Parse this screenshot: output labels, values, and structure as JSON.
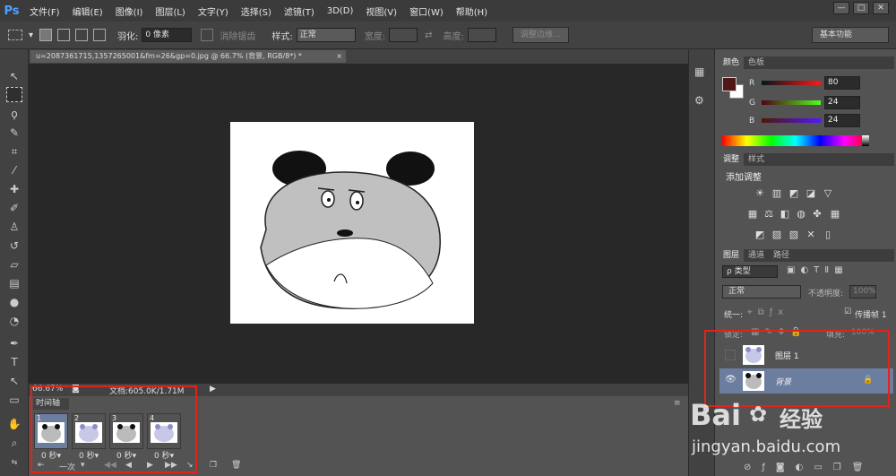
{
  "app": {
    "logo": "Ps",
    "menu": [
      "文件(F)",
      "编辑(E)",
      "图像(I)",
      "图层(L)",
      "文字(Y)",
      "选择(S)",
      "滤镜(T)",
      "3D(D)",
      "视图(V)",
      "窗口(W)",
      "帮助(H)"
    ],
    "window_controls": [
      "—",
      "□",
      "✕"
    ]
  },
  "options_bar": {
    "feather_label": "羽化:",
    "feather_value": "0 像素",
    "antialias_label": "消除锯齿",
    "style_label": "样式:",
    "style_value": "正常",
    "width_label": "宽度:",
    "height_label": "高度:",
    "refine_edge_button": "调整边缘...",
    "workspace_value": "基本功能"
  },
  "document": {
    "tab_title": "u=2087361715,1357265001&fm=26&gp=0.jpg @ 66.7% (背景, RGB/8*) *",
    "tab_close": "×",
    "zoom": "66.67%",
    "doc_info": "文档:605.0K/1.71M"
  },
  "timeline": {
    "tab_label": "时间轴",
    "frames": [
      {
        "num": "1",
        "delay": "0 秒▾"
      },
      {
        "num": "2",
        "delay": "0 秒▾"
      },
      {
        "num": "3",
        "delay": "0 秒▾"
      },
      {
        "num": "4",
        "delay": "0 秒▾"
      }
    ],
    "loop_value": "一次",
    "selected_frame_index": 0
  },
  "color_panel": {
    "tabs": [
      "颜色",
      "色板"
    ],
    "r_label": "R",
    "r_value": "80",
    "g_label": "G",
    "g_value": "24",
    "b_label": "B",
    "b_value": "24",
    "foreground_color": "#501818"
  },
  "adjustments_panel": {
    "tabs": [
      "调整",
      "样式"
    ],
    "title": "添加调整"
  },
  "layers_panel": {
    "tabs": [
      "图层",
      "通道",
      "路径"
    ],
    "filter_value": "ρ 类型",
    "blend_value": "正常",
    "opacity_label": "不透明度:",
    "opacity_value": "100%",
    "unify_label": "统一:",
    "propagate_label": "传播帧 1",
    "lock_label": "锁定:",
    "fill_label": "填充:",
    "fill_value": "100%",
    "layers": [
      {
        "name": "图层 1",
        "visible": false
      },
      {
        "name": "背景",
        "visible": true
      }
    ]
  },
  "watermark": {
    "brand": "Bai",
    "brand_cn": "经验",
    "url": "jingyan.baidu.com"
  },
  "colors": {
    "accent_red": "#e0241b",
    "selection_blue": "#6c7ea0",
    "bg_dark": "#282828"
  }
}
